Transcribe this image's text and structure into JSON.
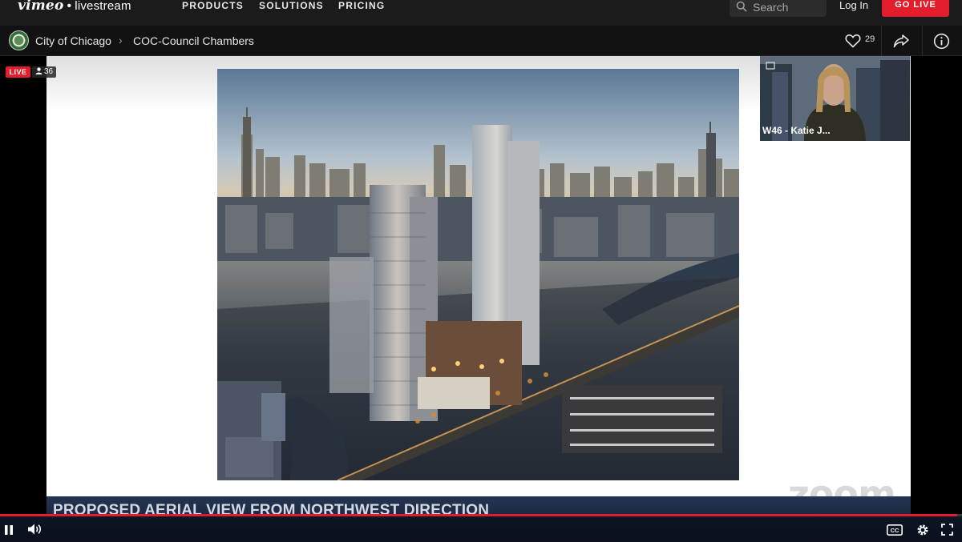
{
  "nav": {
    "brand_vimeo": "vimeo",
    "brand_sep": "•",
    "brand_livestream": "livestream",
    "links": [
      "PRODUCTS",
      "SOLUTIONS",
      "PRICING"
    ],
    "search_placeholder": "Search",
    "login": "Log In",
    "go_live": "GO LIVE"
  },
  "breadcrumb": {
    "account": "City of Chicago",
    "separator": "›",
    "event": "COC-Council Chambers"
  },
  "actions": {
    "likes": "29"
  },
  "player": {
    "live_label": "LIVE",
    "viewers": "36",
    "progress": 0.995
  },
  "slide": {
    "caption": "PROPOSED AERIAL VIEW FROM NORTHWEST DIRECTION",
    "watermark": "zoom"
  },
  "participant": {
    "label": "W46 - Katie J..."
  },
  "colors": {
    "accent": "#e31d2b",
    "nav_bg": "#1b1b1b",
    "caption_bg": "#1f2e48"
  },
  "icons": [
    "search-icon",
    "city-seal-icon",
    "heart-icon",
    "share-icon",
    "info-icon",
    "user-icon",
    "pause-icon",
    "volume-icon",
    "cc-icon",
    "settings-icon",
    "fullscreen-icon"
  ]
}
